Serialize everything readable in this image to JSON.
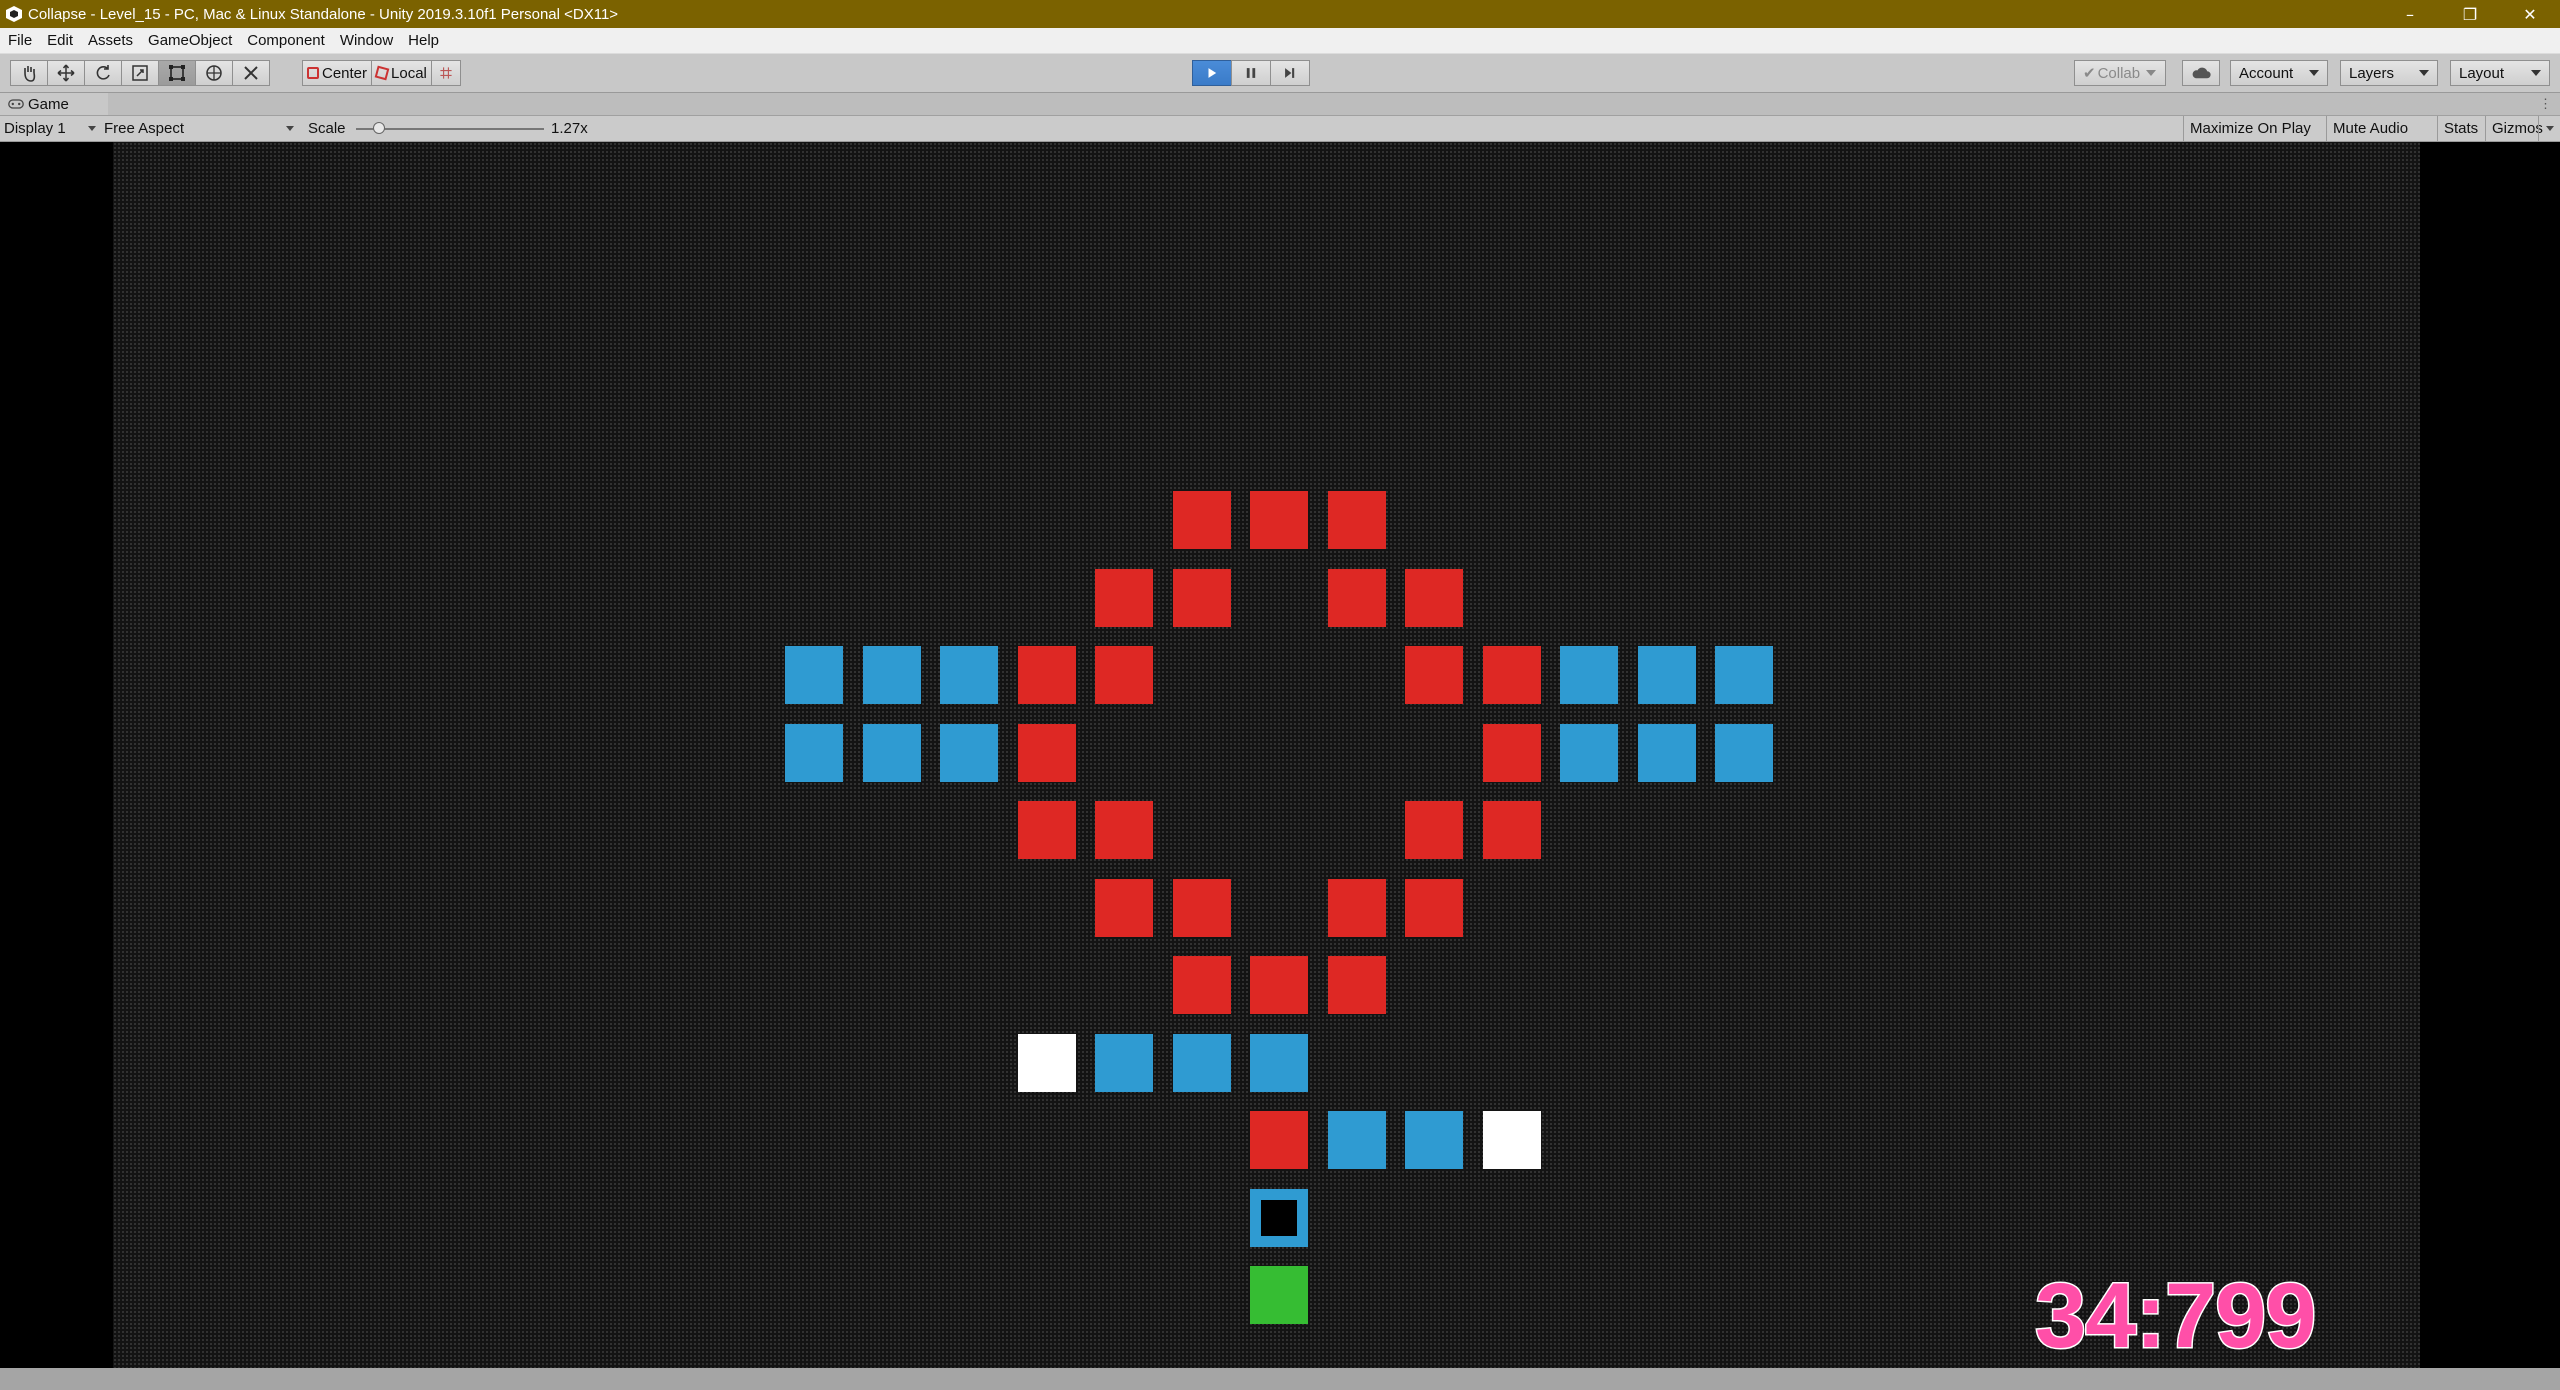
{
  "window": {
    "title": "Collapse - Level_15 - PC, Mac & Linux Standalone - Unity 2019.3.10f1 Personal <DX11>",
    "controls": {
      "minimize": "–",
      "maximize": "❐",
      "close": "✕"
    }
  },
  "menu": [
    "File",
    "Edit",
    "Assets",
    "GameObject",
    "Component",
    "Window",
    "Help"
  ],
  "toolbar": {
    "tools": [
      "hand-tool",
      "move-tool",
      "rotate-tool",
      "scale-tool",
      "rect-tool",
      "transform-tool",
      "custom-tool"
    ],
    "active_tool": "rect-tool",
    "pivot_mode": "Center",
    "pivot_rotation": "Local",
    "play_state": "playing",
    "collab": "Collab",
    "account": "Account",
    "layers": "Layers",
    "layout": "Layout"
  },
  "game_tab": {
    "label": "Game"
  },
  "game_bar": {
    "display": "Display 1",
    "aspect": "Free Aspect",
    "scale_label": "Scale",
    "scale_value": "1.27x",
    "scale_fraction": 0.12,
    "maximize_on_play": "Maximize On Play",
    "mute_audio": "Mute Audio",
    "stats": "Stats",
    "gizmos": "Gizmos"
  },
  "colors": {
    "red_tile": "#de2824",
    "blue_tile": "#2f9bd2",
    "white_tile": "#ffffff",
    "green_tile": "#36bd33",
    "timer": "#ff4fa8",
    "title_bar": "#7b6200"
  },
  "game": {
    "timer": "34:799",
    "grid_rows": [
      "......RRR......",
      ".....RR.RR.....",
      "BBBRR...RRBBB",
      "BBBR.....RBBB",
      "...RR...RR...",
      "....RR.RR....",
      ".....RRR.....",
      "...WBBB......",
      "......RBBW...",
      "......P......",
      "......G......"
    ]
  }
}
